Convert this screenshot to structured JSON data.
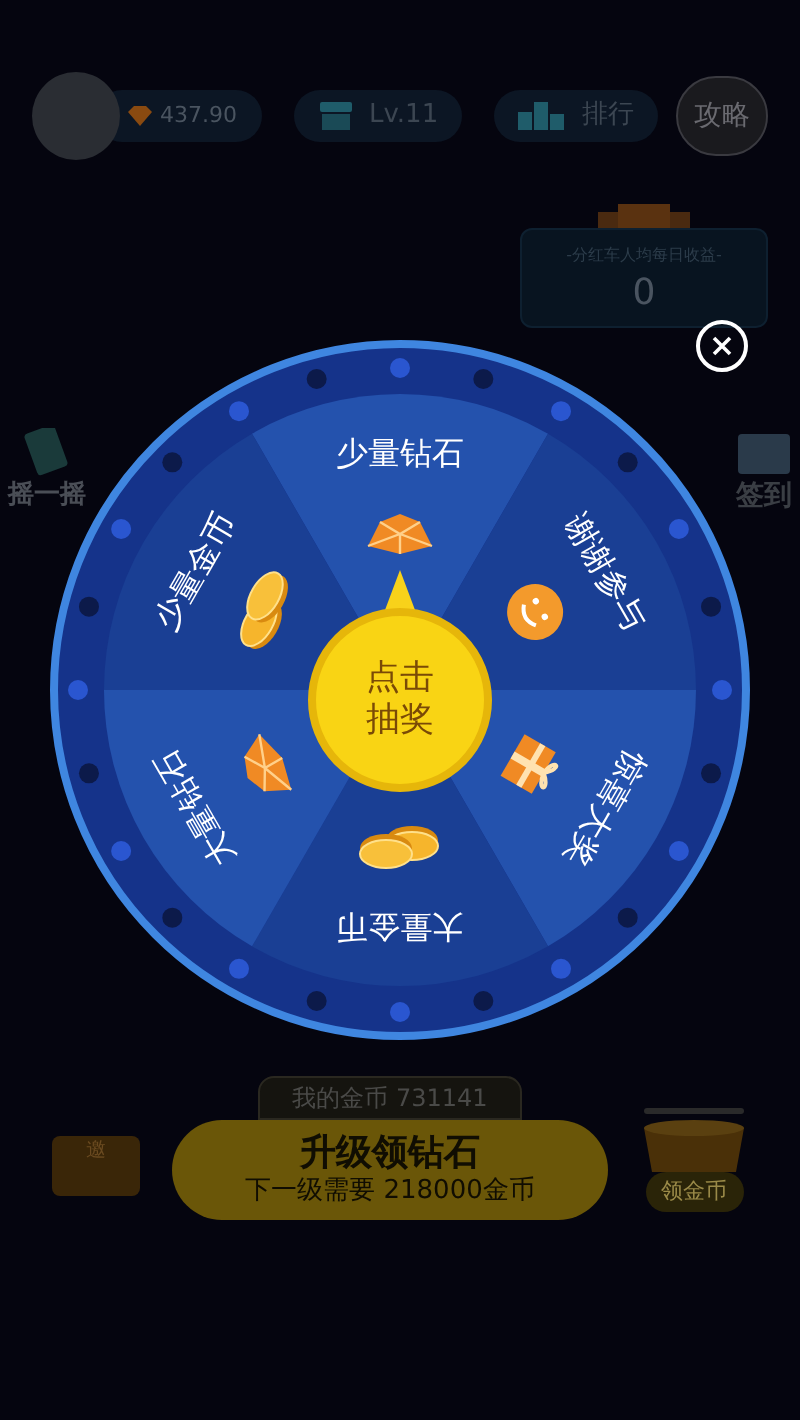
{
  "header": {
    "balance": "437.90",
    "level": "Lv.11",
    "ranking": "排行",
    "guide": "攻略"
  },
  "dividend": {
    "title": "-分红车人均每日收益-",
    "value": "0"
  },
  "side_left": {
    "label": "摇一摇"
  },
  "side_right": {
    "label": "签到"
  },
  "wheel": {
    "center": [
      "点击",
      "抽奖"
    ],
    "segments": [
      {
        "label": "少量钻石",
        "kind": "diamond"
      },
      {
        "label": "谢谢参与",
        "kind": "smile"
      },
      {
        "label": "惊喜大奖",
        "kind": "gift"
      },
      {
        "label": "大量金币",
        "kind": "coin"
      },
      {
        "label": "大量钻石",
        "kind": "diamond"
      },
      {
        "label": "少量金币",
        "kind": "coin"
      }
    ]
  },
  "my_coins": {
    "label": "我的金币 731141"
  },
  "upgrade": {
    "title": "升级领钻石",
    "subtitle": "下一级需要 218000金币"
  },
  "invite": {
    "label": "邀"
  },
  "collect": {
    "label": "领金币"
  }
}
